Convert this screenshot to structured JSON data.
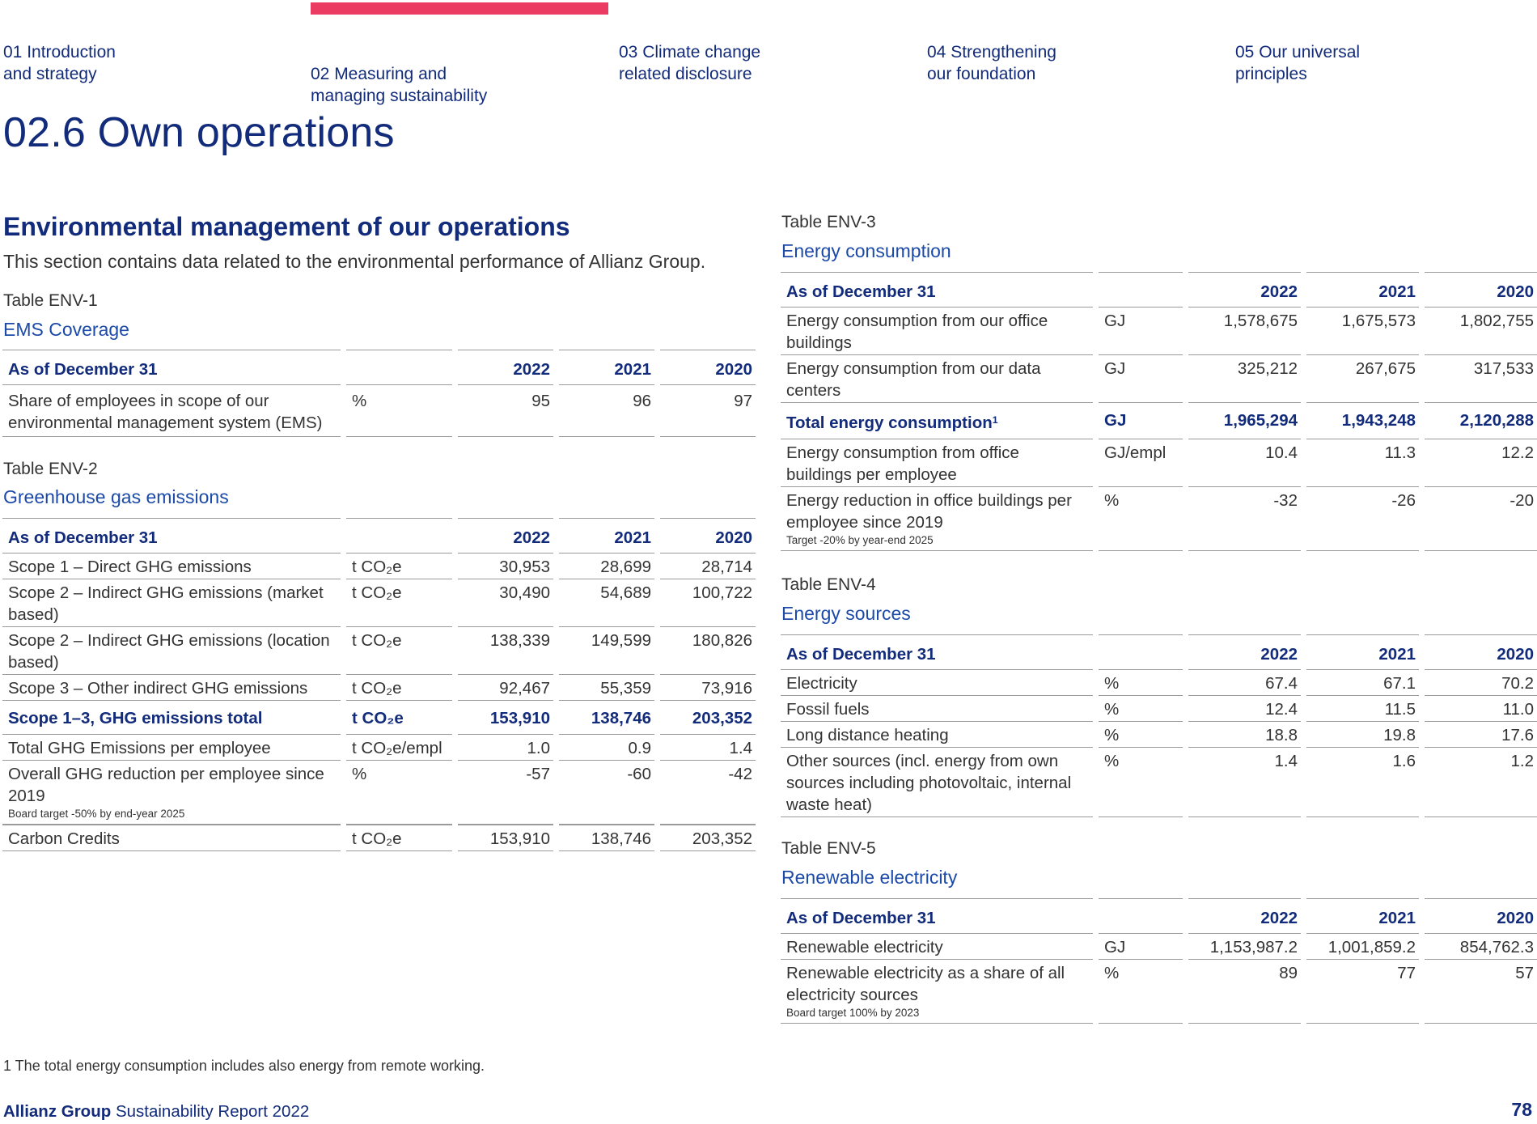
{
  "nav": {
    "items": [
      {
        "label": "01 Introduction\nand strategy"
      },
      {
        "label": "02 Measuring and\nmanaging sustainability"
      },
      {
        "label": "03 Climate change\nrelated disclosure"
      },
      {
        "label": "04 Strengthening\nour foundation"
      },
      {
        "label": "05 Our universal\nprinciples"
      }
    ]
  },
  "page_title": "02.6 Own operations",
  "section": {
    "heading": "Environmental management of our operations",
    "intro": "This section contains data related to the environmental performance of Allianz Group."
  },
  "env1": {
    "label": "Table ENV-1",
    "title": "EMS Coverage",
    "header": {
      "col0": "As of December 31",
      "y2022": "2022",
      "y2021": "2021",
      "y2020": "2020"
    },
    "rows": [
      {
        "name": "Share of employees in scope of our environmental management system (EMS)",
        "unit": "%",
        "v2022": "95",
        "v2021": "96",
        "v2020": "97"
      }
    ]
  },
  "env2": {
    "label": "Table ENV-2",
    "title": "Greenhouse gas emissions",
    "header": {
      "col0": "As of December 31",
      "y2022": "2022",
      "y2021": "2021",
      "y2020": "2020"
    },
    "rows": [
      {
        "name": "Scope 1 – Direct GHG emissions",
        "unit": "t CO₂e",
        "v2022": "30,953",
        "v2021": "28,699",
        "v2020": "28,714"
      },
      {
        "name": "Scope 2 – Indirect GHG emissions (market based)",
        "unit": "t CO₂e",
        "v2022": "30,490",
        "v2021": "54,689",
        "v2020": "100,722"
      },
      {
        "name": "Scope 2 – Indirect GHG emissions (location based)",
        "unit": "t CO₂e",
        "v2022": "138,339",
        "v2021": "149,599",
        "v2020": "180,826"
      },
      {
        "name": "Scope 3 – Other indirect GHG emissions",
        "unit": "t CO₂e",
        "v2022": "92,467",
        "v2021": "55,359",
        "v2020": "73,916"
      },
      {
        "name": "Scope 1–3, GHG emissions total",
        "unit": "t CO₂e",
        "v2022": "153,910",
        "v2021": "138,746",
        "v2020": "203,352"
      },
      {
        "name": "Total GHG Emissions per employee",
        "unit": "t CO₂e/empl",
        "v2022": "1.0",
        "v2021": "0.9",
        "v2020": "1.4"
      },
      {
        "name": "Overall GHG reduction per employee since 2019",
        "note": "Board target -50% by end-year 2025",
        "unit": "%",
        "v2022": "-57",
        "v2021": "-60",
        "v2020": "-42"
      },
      {
        "name": "Carbon Credits",
        "unit": "t CO₂e",
        "v2022": "153,910",
        "v2021": "138,746",
        "v2020": "203,352"
      }
    ]
  },
  "env3": {
    "label": "Table ENV-3",
    "title": "Energy consumption",
    "header": {
      "col0": "As of December 31",
      "y2022": "2022",
      "y2021": "2021",
      "y2020": "2020"
    },
    "rows": [
      {
        "name": "Energy consumption from our office buildings",
        "unit": "GJ",
        "v2022": "1,578,675",
        "v2021": "1,675,573",
        "v2020": "1,802,755"
      },
      {
        "name": "Energy consumption from our data centers",
        "unit": "GJ",
        "v2022": "325,212",
        "v2021": "267,675",
        "v2020": "317,533"
      },
      {
        "name": "Total energy consumption",
        "footnote_mark": "1",
        "unit": "GJ",
        "v2022": "1,965,294",
        "v2021": "1,943,248",
        "v2020": "2,120,288"
      },
      {
        "name": "Energy consumption from office buildings per employee",
        "unit": "GJ/empl",
        "v2022": "10.4",
        "v2021": "11.3",
        "v2020": "12.2"
      },
      {
        "name": "Energy reduction in office buildings per employee since 2019",
        "note": "Target -20% by year-end 2025",
        "unit": "%",
        "v2022": "-32",
        "v2021": "-26",
        "v2020": "-20"
      }
    ]
  },
  "env4": {
    "label": "Table ENV-4",
    "title": "Energy sources",
    "header": {
      "col0": "As of December 31",
      "y2022": "2022",
      "y2021": "2021",
      "y2020": "2020"
    },
    "rows": [
      {
        "name": "Electricity",
        "unit": "%",
        "v2022": "67.4",
        "v2021": "67.1",
        "v2020": "70.2"
      },
      {
        "name": "Fossil fuels",
        "unit": "%",
        "v2022": "12.4",
        "v2021": "11.5",
        "v2020": "11.0"
      },
      {
        "name": "Long distance heating",
        "unit": "%",
        "v2022": "18.8",
        "v2021": "19.8",
        "v2020": "17.6"
      },
      {
        "name": "Other sources (incl. energy from own sources including photovoltaic, internal waste heat)",
        "unit": "%",
        "v2022": "1.4",
        "v2021": "1.6",
        "v2020": "1.2"
      }
    ]
  },
  "env5": {
    "label": "Table ENV-5",
    "title": "Renewable electricity",
    "header": {
      "col0": "As of December 31",
      "y2022": "2022",
      "y2021": "2021",
      "y2020": "2020"
    },
    "rows": [
      {
        "name": "Renewable electricity",
        "unit": "GJ",
        "v2022": "1,153,987.2",
        "v2021": "1,001,859.2",
        "v2020": "854,762.3"
      },
      {
        "name": "Renewable electricity as a share of all electricity sources",
        "note": "Board target 100% by 2023",
        "unit": "%",
        "v2022": "89",
        "v2021": "77",
        "v2020": "57"
      }
    ]
  },
  "footnote": "1  The total energy consumption includes also energy from remote working.",
  "footer": {
    "brand": "Allianz Group",
    "title": " Sustainability Report 2022",
    "page": "78"
  }
}
